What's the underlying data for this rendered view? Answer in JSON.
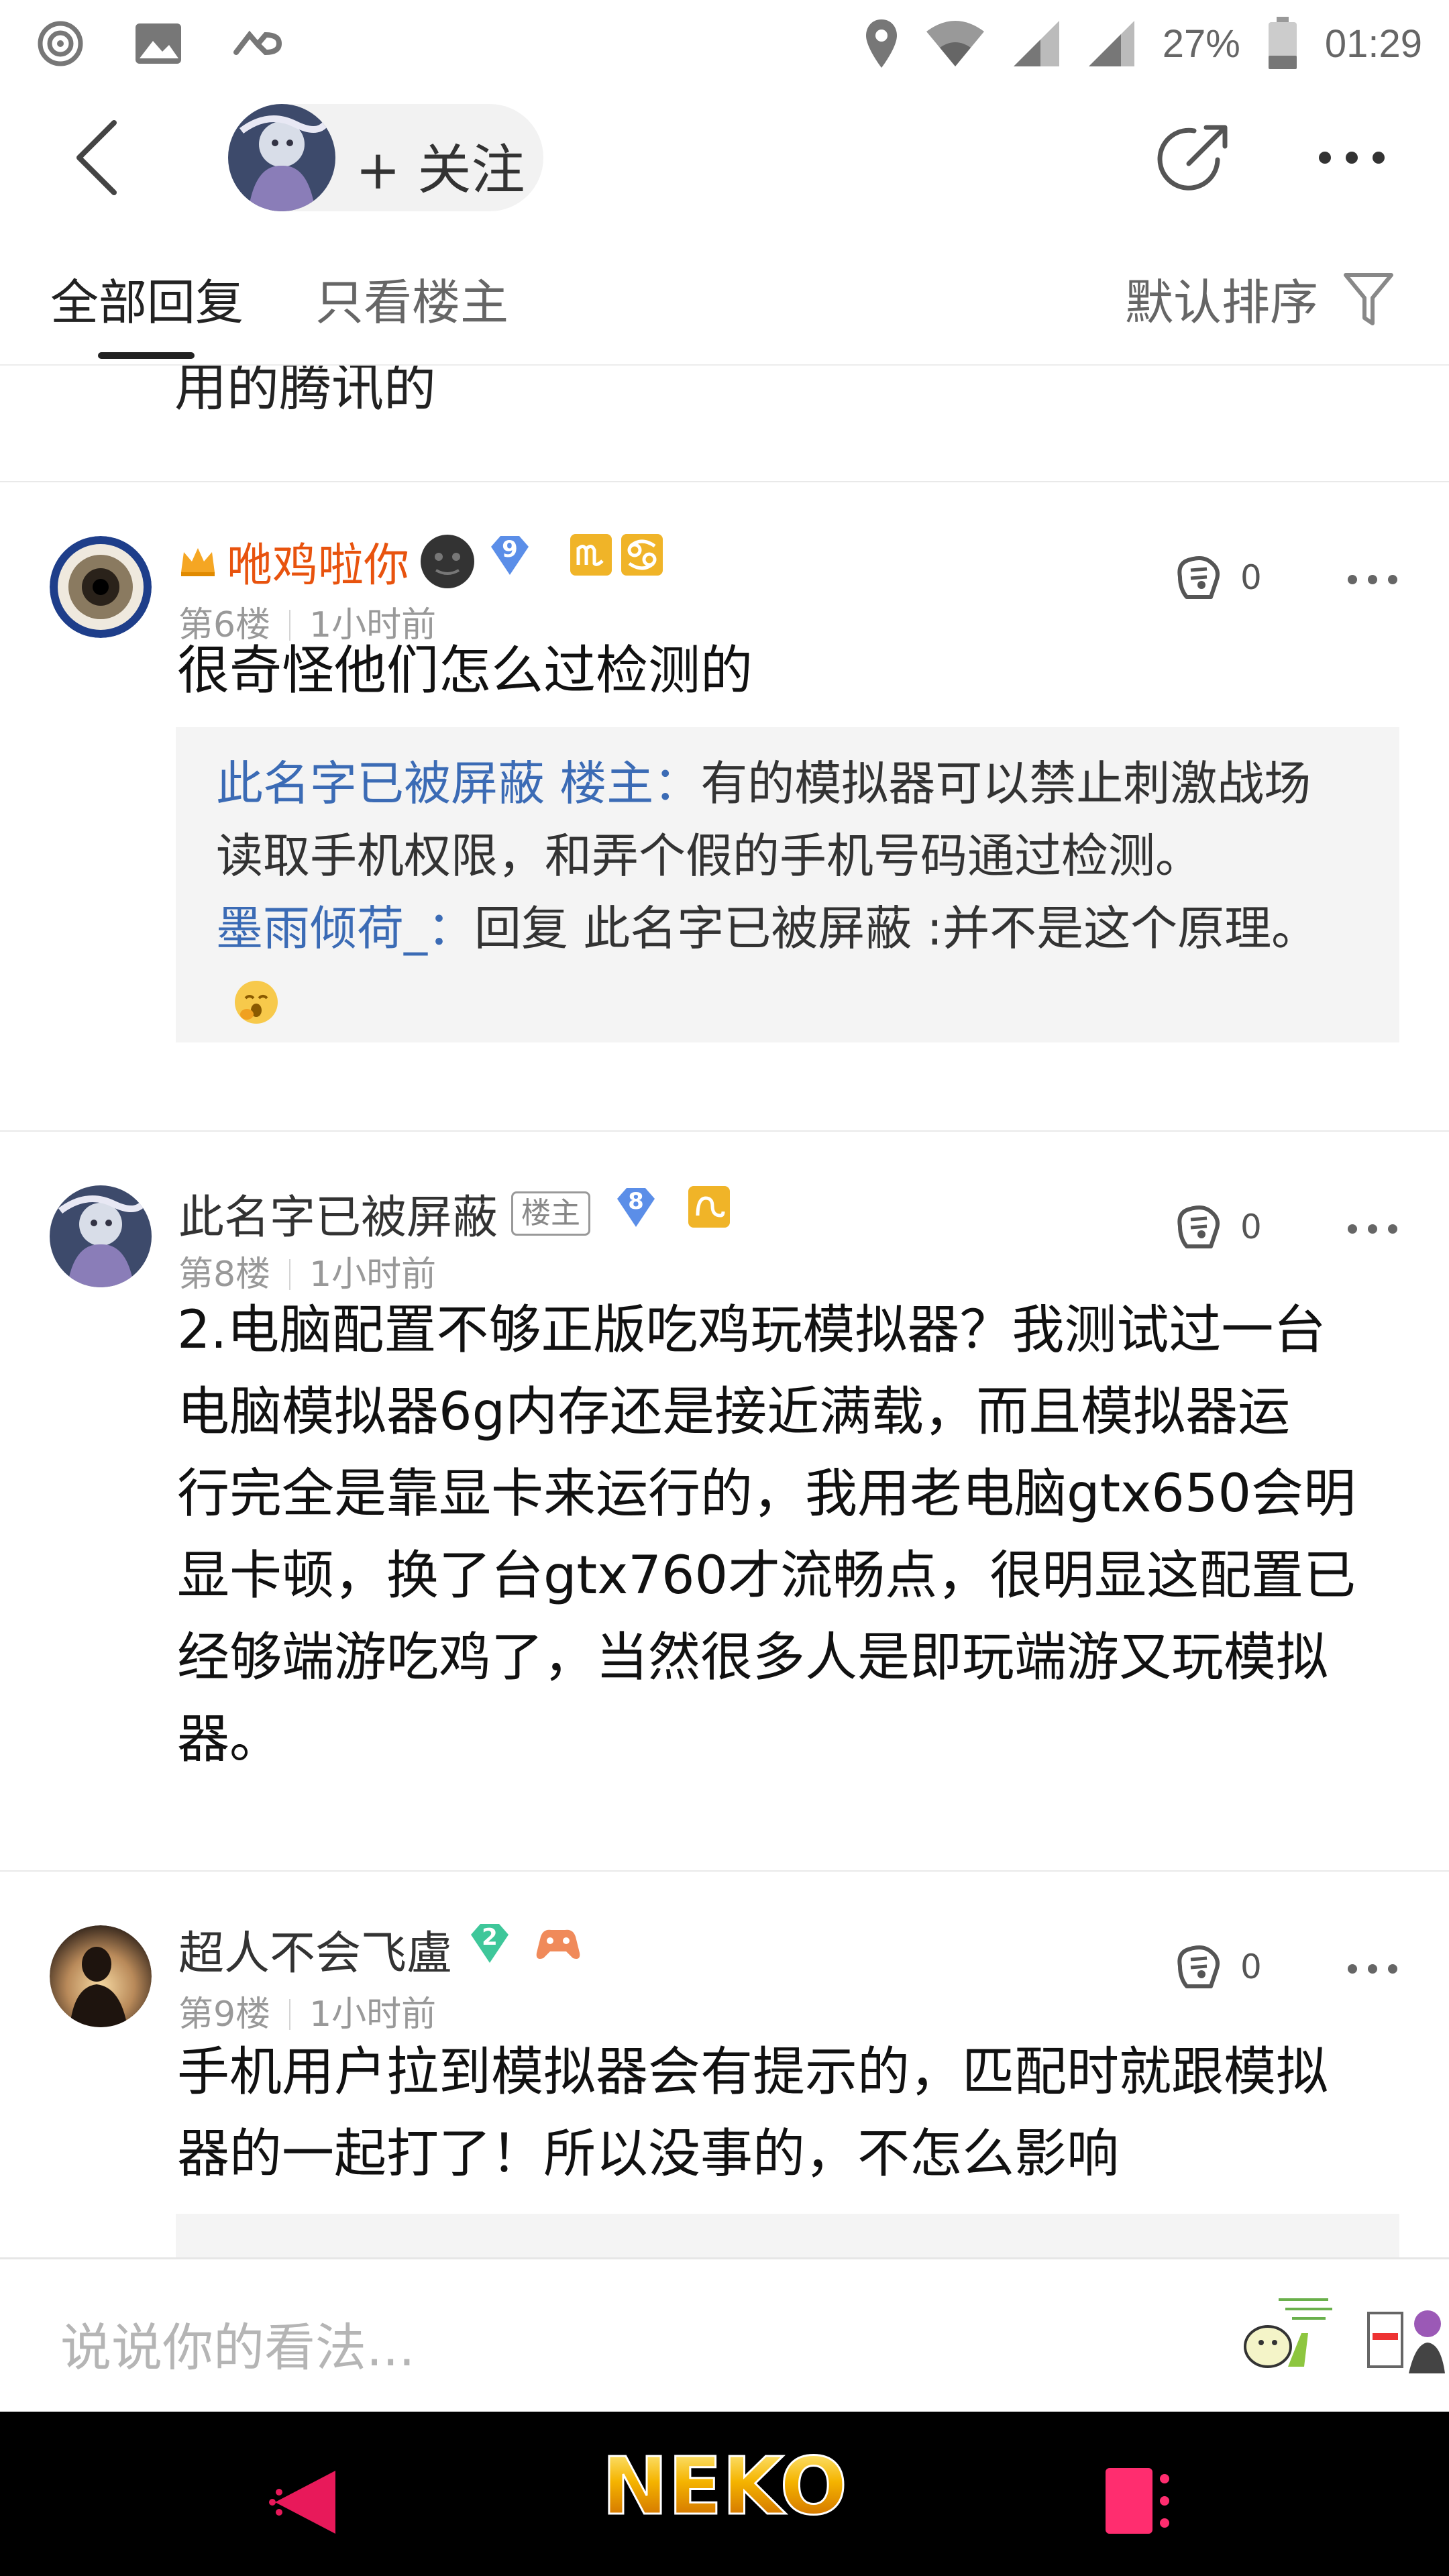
{
  "status_bar": {
    "battery": "27%",
    "time": "01:29"
  },
  "navbar": {
    "follow_label": "+ 关注"
  },
  "tabs": {
    "all": "全部回复",
    "op_only": "只看楼主",
    "sort": "默认排序"
  },
  "feed": {
    "partial_text": "用的腾讯的",
    "posts": [
      {
        "username": "咃鸡啦你",
        "level": "9",
        "floor": "第6楼",
        "time": "1小时前",
        "likes": "0",
        "body": "很奇怪他们怎么过检测的",
        "replies": [
          {
            "name": "此名字已被屏蔽 楼主",
            "colon": "：",
            "text": "有的模拟器可以禁止刺激战场读取手机权限，和弄个假的手机号码通过检测。"
          },
          {
            "name": "墨雨倾荷_",
            "colon": "：",
            "text": "回复 此名字已被屏蔽 :并不是这个原理。"
          }
        ]
      },
      {
        "username": "此名字已被屏蔽",
        "op_tag": "楼主",
        "level": "8",
        "floor": "第8楼",
        "time": "1小时前",
        "likes": "0",
        "body_lines": [
          "2.电脑配置不够正版吃鸡玩模拟器？我测试过一台",
          "电脑模拟器6g内存还是接近满载，而且模拟器运",
          "行完全是靠显卡来运行的，我用老电脑gtx650会明",
          "显卡顿，换了台gtx760才流畅点，很明显这配置已",
          "经够端游吃鸡了，当然很多人是即玩端游又玩模拟",
          "器。"
        ]
      },
      {
        "username": "超人不会飞盧",
        "level": "2",
        "floor": "第9楼",
        "time": "1小时前",
        "likes": "0",
        "body_lines": [
          "手机用户拉到模拟器会有提示的，匹配时就跟模拟",
          "器的一起打了！所以没事的，不怎么影响"
        ]
      }
    ]
  },
  "input": {
    "placeholder": "说说你的看法..."
  },
  "sysnav": {
    "logo_text": "NEKO"
  },
  "colors": {
    "accent_blue": "#3b6bb5",
    "vip_name": "#e8530e",
    "quote_bg": "#f4f4f4",
    "nav_back": "#e8195a",
    "nav_recent": "#ff2d6f"
  },
  "icons": [
    "signal-icon",
    "image-icon",
    "infinity-icon",
    "location-icon",
    "wifi-icon",
    "cell-signal-icon",
    "battery-icon",
    "back-arrow-icon",
    "share-icon",
    "more-dots-icon",
    "filter-funnel-icon",
    "like-fist-icon",
    "crown-icon",
    "diamond-level-icon",
    "zodiac-badge-icon",
    "emoji-icon",
    "sticker-icon",
    "nav-back-icon",
    "nav-recent-icon"
  ]
}
